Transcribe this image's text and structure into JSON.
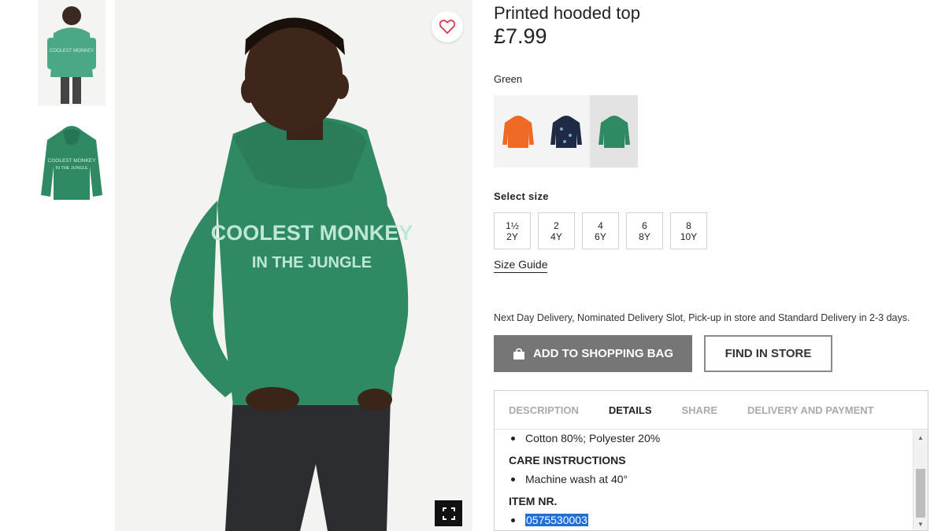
{
  "product": {
    "title": "Printed hooded top",
    "price": "£7.99",
    "color_name": "Green",
    "hoodie_print_line1": "COOLEST MONKEY",
    "hoodie_print_line2": "IN THE JUNGLE"
  },
  "swatches": [
    {
      "name": "Orange",
      "color": "#ee6a25"
    },
    {
      "name": "Navy",
      "color": "#1f2a44"
    },
    {
      "name": "Green",
      "color": "#2f8a63"
    }
  ],
  "size": {
    "label": "Select size",
    "options": [
      {
        "line1": "1½",
        "line2": "2Y"
      },
      {
        "line1": "2",
        "line2": "4Y"
      },
      {
        "line1": "4",
        "line2": "6Y"
      },
      {
        "line1": "6",
        "line2": "8Y"
      },
      {
        "line1": "8",
        "line2": "10Y"
      }
    ],
    "guide_link": "Size Guide"
  },
  "delivery_text": "Next Day Delivery, Nominated Delivery Slot, Pick-up in store and Standard Delivery in 2-3 days.",
  "actions": {
    "add_to_bag": "ADD TO SHOPPING BAG",
    "find_in_store": "FIND IN STORE"
  },
  "tabs": [
    "DESCRIPTION",
    "DETAILS",
    "SHARE",
    "DELIVERY AND PAYMENT"
  ],
  "active_tab": "DETAILS",
  "details": {
    "composition": "Cotton 80%; Polyester 20%",
    "care_heading": "CARE INSTRUCTIONS",
    "care_item": "Machine wash at 40°",
    "item_heading": "ITEM NR.",
    "item_number": "0575530003"
  },
  "colors": {
    "hoodie_green": "#2f8a63",
    "button_grey": "#767676",
    "selection_blue": "#1f6fd9",
    "heart_red": "#d9384a"
  },
  "icons": [
    "heart-icon",
    "fullscreen-icon",
    "shopping-bag-icon",
    "scroll-up-icon",
    "scroll-down-icon"
  ]
}
